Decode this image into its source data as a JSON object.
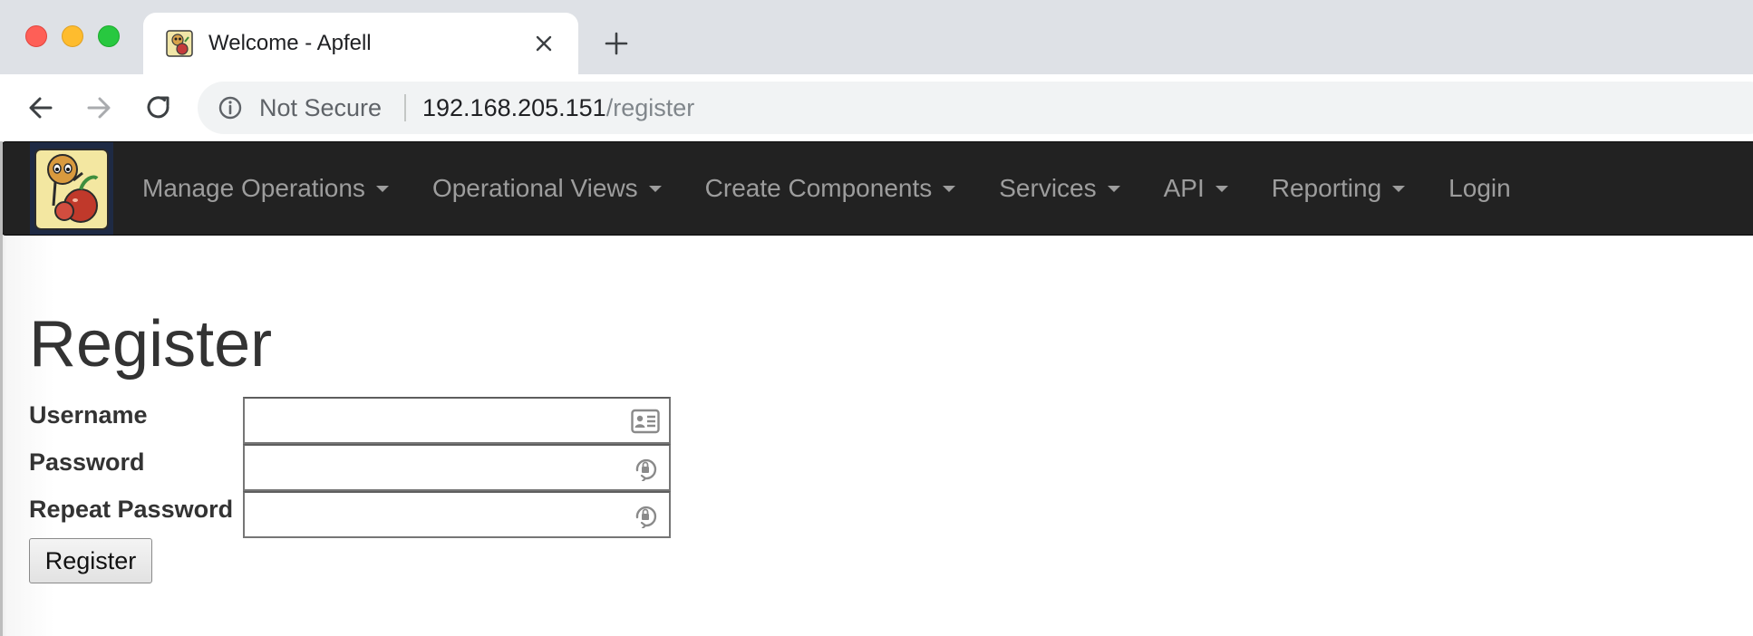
{
  "browser": {
    "tab": {
      "title": "Welcome - Apfell",
      "favicon": "apfell-logo-icon"
    },
    "omnibox": {
      "security_label": "Not Secure",
      "url_host": "192.168.205.151",
      "url_path": "/register"
    }
  },
  "navbar": {
    "items": [
      {
        "label": "Manage Operations",
        "dropdown": true
      },
      {
        "label": "Operational Views",
        "dropdown": true
      },
      {
        "label": "Create Components",
        "dropdown": true
      },
      {
        "label": "Services",
        "dropdown": true
      },
      {
        "label": "API",
        "dropdown": true
      },
      {
        "label": "Reporting",
        "dropdown": true
      },
      {
        "label": "Login",
        "dropdown": false
      }
    ]
  },
  "page": {
    "title": "Register",
    "form": {
      "username_label": "Username",
      "username_value": "",
      "password_label": "Password",
      "password_value": "",
      "repeat_password_label": "Repeat Password",
      "repeat_password_value": "",
      "submit_label": "Register"
    }
  },
  "colors": {
    "navbar_bg": "#222222",
    "navbar_text": "#9d9d9d",
    "tabstrip_bg": "#dee1e6",
    "heading_text": "#333333"
  }
}
